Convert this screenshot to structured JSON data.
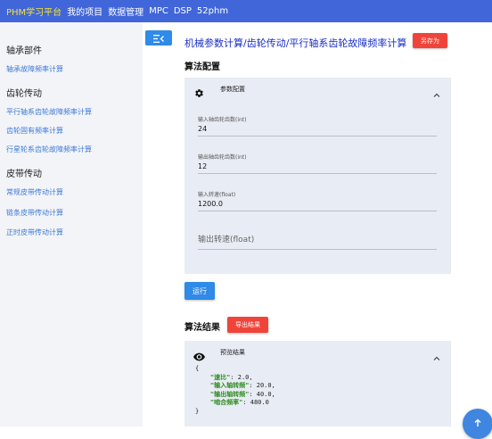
{
  "topbar": {
    "brand": "PHM学习平台",
    "nav": [
      "我的项目",
      "数据管理",
      "MPC",
      "DSP",
      "52phm"
    ]
  },
  "sidebar": {
    "groups": [
      {
        "title": "轴承部件",
        "items": [
          "轴承故障频率计算"
        ]
      },
      {
        "title": "齿轮传动",
        "items": [
          "平行轴系齿轮故障频率计算",
          "齿轮固有频率计算",
          "行星轮系齿轮故障频率计算"
        ]
      },
      {
        "title": "皮带传动",
        "items": [
          "常规皮带传动计算",
          "链条皮带传动计算",
          "正时皮带传动计算"
        ]
      }
    ]
  },
  "main": {
    "title": "机械参数计算/齿轮传动/平行轴系齿轮故障频率计算",
    "save_as_label": "另存为",
    "config_heading": "算法配置",
    "param_panel_title": "参数配置",
    "fields": [
      {
        "label": "输入轴齿轮齿数(int)",
        "value": "24"
      },
      {
        "label": "输出轴齿轮齿数(int)",
        "value": "12"
      },
      {
        "label": "输入转速(float)",
        "value": "1200.0"
      }
    ],
    "output_speed_placeholder": "输出转速(float)",
    "run_label": "运行",
    "result_heading": "算法结果",
    "export_label": "导出结果",
    "preview_panel_title": "预览结果",
    "result_lines": [
      {
        "key": "\"速比\"",
        "value": "2.0,"
      },
      {
        "key": "\"输入轴转频\"",
        "value": "20.0,"
      },
      {
        "key": "\"输出轴转频\"",
        "value": "40.0,"
      },
      {
        "key": "\"啮合频率\"",
        "value": "480.0"
      }
    ]
  },
  "colors": {
    "topbar": "#4166d9",
    "brand": "#f5e23a",
    "link": "#3b78d8",
    "title": "#1a2ec8",
    "primary": "#2f8ae8",
    "danger": "#f0443a",
    "panel": "#e8ecf4",
    "json_key": "#2e8b20"
  },
  "icons": [
    "menu-collapse-icon",
    "gear-icon",
    "chevron-up-icon",
    "eye-icon",
    "arrow-up-icon"
  ]
}
